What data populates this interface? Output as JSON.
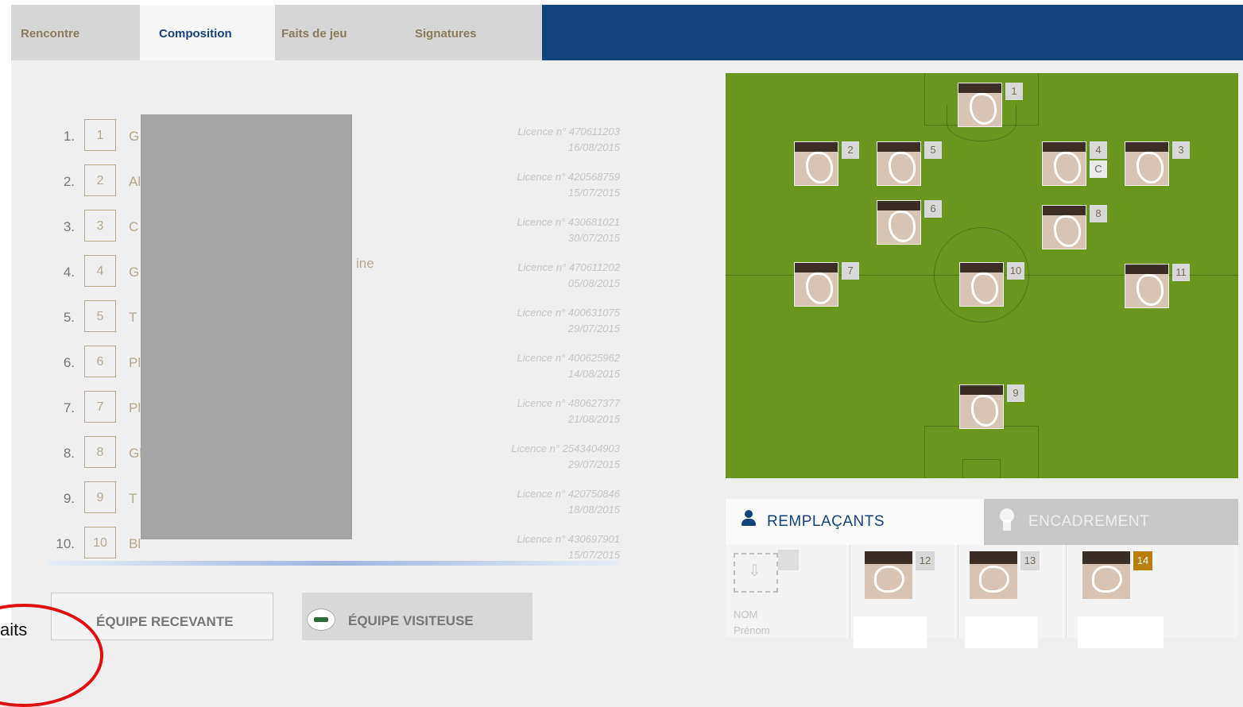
{
  "tabs": [
    {
      "label": "Rencontre",
      "active": false
    },
    {
      "label": "Composition",
      "active": true
    },
    {
      "label": "Faits de jeu",
      "active": false
    },
    {
      "label": "Signatures",
      "active": false
    }
  ],
  "players": [
    {
      "index": "1.",
      "number": "1",
      "name": "G",
      "licence": "Licence n° 470611203",
      "date": "16/08/2015"
    },
    {
      "index": "2.",
      "number": "2",
      "name": "Al",
      "licence": "Licence n° 420568759",
      "date": "15/07/2015"
    },
    {
      "index": "3.",
      "number": "3",
      "name": "C",
      "licence": "Licence n° 430681021",
      "date": "30/07/2015"
    },
    {
      "index": "4.",
      "number": "4",
      "name": "G",
      "licence": "Licence n° 470611202",
      "date": "05/08/2015"
    },
    {
      "index": "5.",
      "number": "5",
      "name": "T",
      "licence": "Licence n° 400631075",
      "date": "29/07/2015"
    },
    {
      "index": "6.",
      "number": "6",
      "name": "Pl",
      "licence": "Licence n° 400625962",
      "date": "14/08/2015"
    },
    {
      "index": "7.",
      "number": "7",
      "name": "Pl",
      "licence": "Licence n° 480627377",
      "date": "21/08/2015"
    },
    {
      "index": "8.",
      "number": "8",
      "name": "Gl",
      "licence": "Licence n° 2543404903",
      "date": "29/07/2015"
    },
    {
      "index": "9.",
      "number": "9",
      "name": "T",
      "licence": "Licence n° 420750846",
      "date": "18/08/2015"
    },
    {
      "index": "10.",
      "number": "10",
      "name": "Bl",
      "licence": "Licence n° 430697901",
      "date": "15/07/2015"
    }
  ],
  "partial_text_row4": "ine",
  "team_buttons": {
    "home": "ÉQUIPE RECEVANTE",
    "away": "ÉQUIPE VISITEUSE"
  },
  "pitch_players": [
    {
      "number": "1"
    },
    {
      "number": "2"
    },
    {
      "number": "5"
    },
    {
      "number": "4",
      "captain": "C"
    },
    {
      "number": "3"
    },
    {
      "number": "6"
    },
    {
      "number": "8"
    },
    {
      "number": "7"
    },
    {
      "number": "10"
    },
    {
      "number": "11"
    },
    {
      "number": "9"
    }
  ],
  "panel_tabs": {
    "substitutes": "REMPLAÇANTS",
    "staff": "ENCADREMENT"
  },
  "add_slot": {
    "name": "NOM",
    "firstname": "Prénom"
  },
  "substitutes": [
    {
      "number": "12",
      "highlight": false
    },
    {
      "number": "13",
      "highlight": false
    },
    {
      "number": "14",
      "highlight": true
    }
  ],
  "annotation_text": "aits",
  "colors": {
    "brand_blue": "#14427a",
    "pitch_green": "#6b961e",
    "gold_text": "#b9a88c",
    "highlight_badge": "#b77e0b",
    "annotation_red": "#e01010"
  }
}
